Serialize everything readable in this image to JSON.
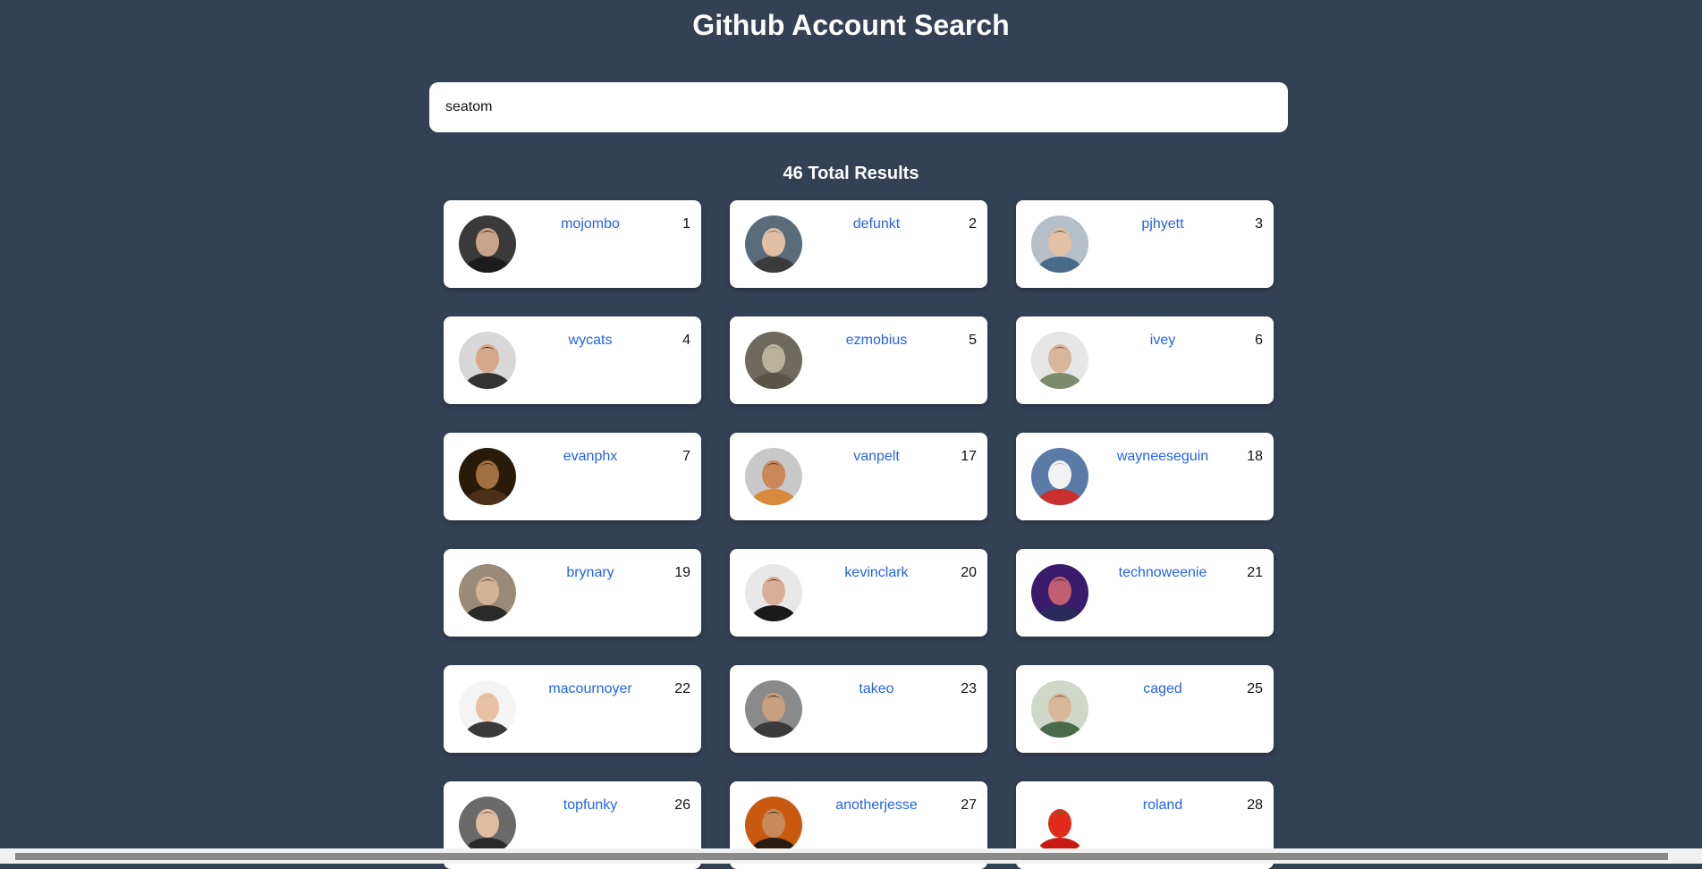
{
  "page": {
    "title": "Github Account Search"
  },
  "search": {
    "value": "seatom",
    "placeholder": ""
  },
  "results": {
    "summary": "46 Total Results",
    "users": [
      {
        "login": "mojombo",
        "id": "1",
        "skin": "#c9a48a",
        "hair": "#2a1f1a",
        "bg": "#3a3a3a",
        "shirt": "#1c1c1c"
      },
      {
        "login": "defunkt",
        "id": "2",
        "skin": "#e0bfa5",
        "hair": "#8a6a4a",
        "bg": "#5a6b7a",
        "shirt": "#3b3b3b"
      },
      {
        "login": "pjhyett",
        "id": "3",
        "skin": "#e2c1a6",
        "hair": "#2b3f5e",
        "bg": "#b5bfc8",
        "shirt": "#4a6a8a"
      },
      {
        "login": "wycats",
        "id": "4",
        "skin": "#d6a98a",
        "hair": "#2a2018",
        "bg": "#d8d8d8",
        "shirt": "#333333"
      },
      {
        "login": "ezmobius",
        "id": "5",
        "skin": "#b9b39c",
        "hair": "#8a8674",
        "bg": "#6e6a5e",
        "shirt": "#5a5546"
      },
      {
        "login": "ivey",
        "id": "6",
        "skin": "#d9b59a",
        "hair": "#6a5240",
        "bg": "#e6e6e6",
        "shirt": "#7a8a6a"
      },
      {
        "login": "evanphx",
        "id": "7",
        "skin": "#a07040",
        "hair": "#3a2510",
        "bg": "#2a1a0a",
        "shirt": "#4a3018"
      },
      {
        "login": "vanpelt",
        "id": "17",
        "skin": "#c9875a",
        "hair": "#5a3a20",
        "bg": "#c8c8c8",
        "shirt": "#d88a3a"
      },
      {
        "login": "wayneeseguin",
        "id": "18",
        "skin": "#f2f2f2",
        "hair": "#e8a0a8",
        "bg": "#5a7aa8",
        "shirt": "#c83030"
      },
      {
        "login": "brynary",
        "id": "19",
        "skin": "#d4b294",
        "hair": "#4a3a2a",
        "bg": "#9a8a78",
        "shirt": "#2a2a2a"
      },
      {
        "login": "kevinclark",
        "id": "20",
        "skin": "#d9b096",
        "hair": "#3a2a20",
        "bg": "#e8e8e8",
        "shirt": "#1a1a1a"
      },
      {
        "login": "technoweenie",
        "id": "21",
        "skin": "#c06070",
        "hair": "#2a1a3a",
        "bg": "#3a1a6a",
        "shirt": "#2a2a5a"
      },
      {
        "login": "macournoyer",
        "id": "22",
        "skin": "#e8c0a4",
        "hair": "#d8b090",
        "bg": "#f4f4f4",
        "shirt": "#3a3a3a"
      },
      {
        "login": "takeo",
        "id": "23",
        "skin": "#c8a080",
        "hair": "#2a2018",
        "bg": "#8a8a8a",
        "shirt": "#3a3a3a"
      },
      {
        "login": "caged",
        "id": "25",
        "skin": "#d8b898",
        "hair": "#5a4030",
        "bg": "#cfd8c8",
        "shirt": "#4a6a4a"
      },
      {
        "login": "topfunky",
        "id": "26",
        "skin": "#e0bca0",
        "hair": "#6a5038",
        "bg": "#6a6a6a",
        "shirt": "#2a2a2a"
      },
      {
        "login": "anotherjesse",
        "id": "27",
        "skin": "#c88a5a",
        "hair": "#3a2010",
        "bg": "#c85a10",
        "shirt": "#2a1a10"
      },
      {
        "login": "roland",
        "id": "28",
        "skin": "#e02a1a",
        "hair": "#3a8a2a",
        "bg": "#ffffff",
        "shirt": "#c81a10"
      }
    ]
  },
  "colors": {
    "background": "#334155",
    "link": "#2563eb",
    "card": "#ffffff"
  }
}
